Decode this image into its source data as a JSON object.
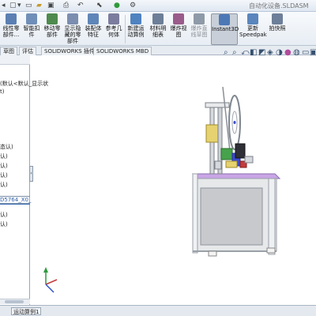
{
  "title_bar": {
    "document_title": "自动化设备.SLDASM",
    "quick_access": [
      "new-icon",
      "open-icon",
      "print-icon",
      "undo-icon",
      "select-icon",
      "rebuild-icon",
      "options-icon"
    ]
  },
  "ribbon": {
    "buttons": [
      {
        "label": "线性零\n部件...",
        "icon": "linear-pattern-icon",
        "color": "#5b7fb3"
      },
      {
        "label": "智能扣\n件",
        "icon": "smart-fasteners-icon",
        "color": "#6f8fb8"
      },
      {
        "label": "移动零\n部件",
        "icon": "move-component-icon",
        "color": "#4e8a4e"
      },
      {
        "label": "显示隐\n藏的零\n部件",
        "icon": "show-hidden-icon",
        "color": "#7b8eb0"
      },
      {
        "label": "装配体\n特征",
        "icon": "assembly-feature-icon",
        "color": "#5f86b8"
      },
      {
        "label": "参考几\n何体",
        "icon": "reference-geometry-icon",
        "color": "#7c7c9e"
      },
      {
        "label": "新建运\n动算例",
        "icon": "motion-study-icon",
        "color": "#4f83c0"
      },
      {
        "label": "材料明\n细表",
        "icon": "bom-icon",
        "color": "#6d7f98"
      },
      {
        "label": "爆炸视\n图",
        "icon": "exploded-view-icon",
        "color": "#9a5b8b"
      },
      {
        "label": "爆炸直\n线草图",
        "icon": "explode-line-icon",
        "color": "#8f9aa8"
      },
      {
        "label": "Instant3D",
        "icon": "instant3d-icon",
        "color": "#4c78b5",
        "active": true
      },
      {
        "label": "更新\nSpeedpak",
        "icon": "speedpak-icon",
        "color": "#5a86bd"
      },
      {
        "label": "拍快照",
        "icon": "snapshot-icon",
        "color": "#6d7f99"
      }
    ]
  },
  "tabs": [
    "草图",
    "评估",
    "SOLIDWORKS 插件",
    "SOLIDWORKS MBD"
  ],
  "feature_manager": {
    "rows": [
      {
        "text": "(默认<默认_显示状"
      },
      {
        "text": "t)"
      },
      {
        "text": "态认)"
      },
      {
        "text": "认)"
      },
      {
        "text": "认)"
      },
      {
        "text": "认)"
      },
      {
        "text": "认)"
      },
      {
        "text": "D5764_X0_"
      },
      {
        "text": "认)"
      },
      {
        "text": "认)"
      }
    ]
  },
  "hud_icons": [
    "zoom-fit-icon",
    "zoom-area-icon",
    "previous-view-icon",
    "section-view-icon",
    "view-orientation-icon",
    "display-style-icon",
    "hide-show-icon",
    "edit-appearance-icon",
    "scene-icon",
    "view-settings-icon",
    "monitor-icon"
  ],
  "status_tabs": [
    "运动算例1"
  ],
  "colors": {
    "frame": "#d9dde3",
    "plate": "#c9a6e6",
    "panel": "#c7c9cc",
    "yellow": "#e6d270",
    "blue": "#3b4bcf",
    "green": "#47a24c",
    "red": "#c63a3a"
  }
}
